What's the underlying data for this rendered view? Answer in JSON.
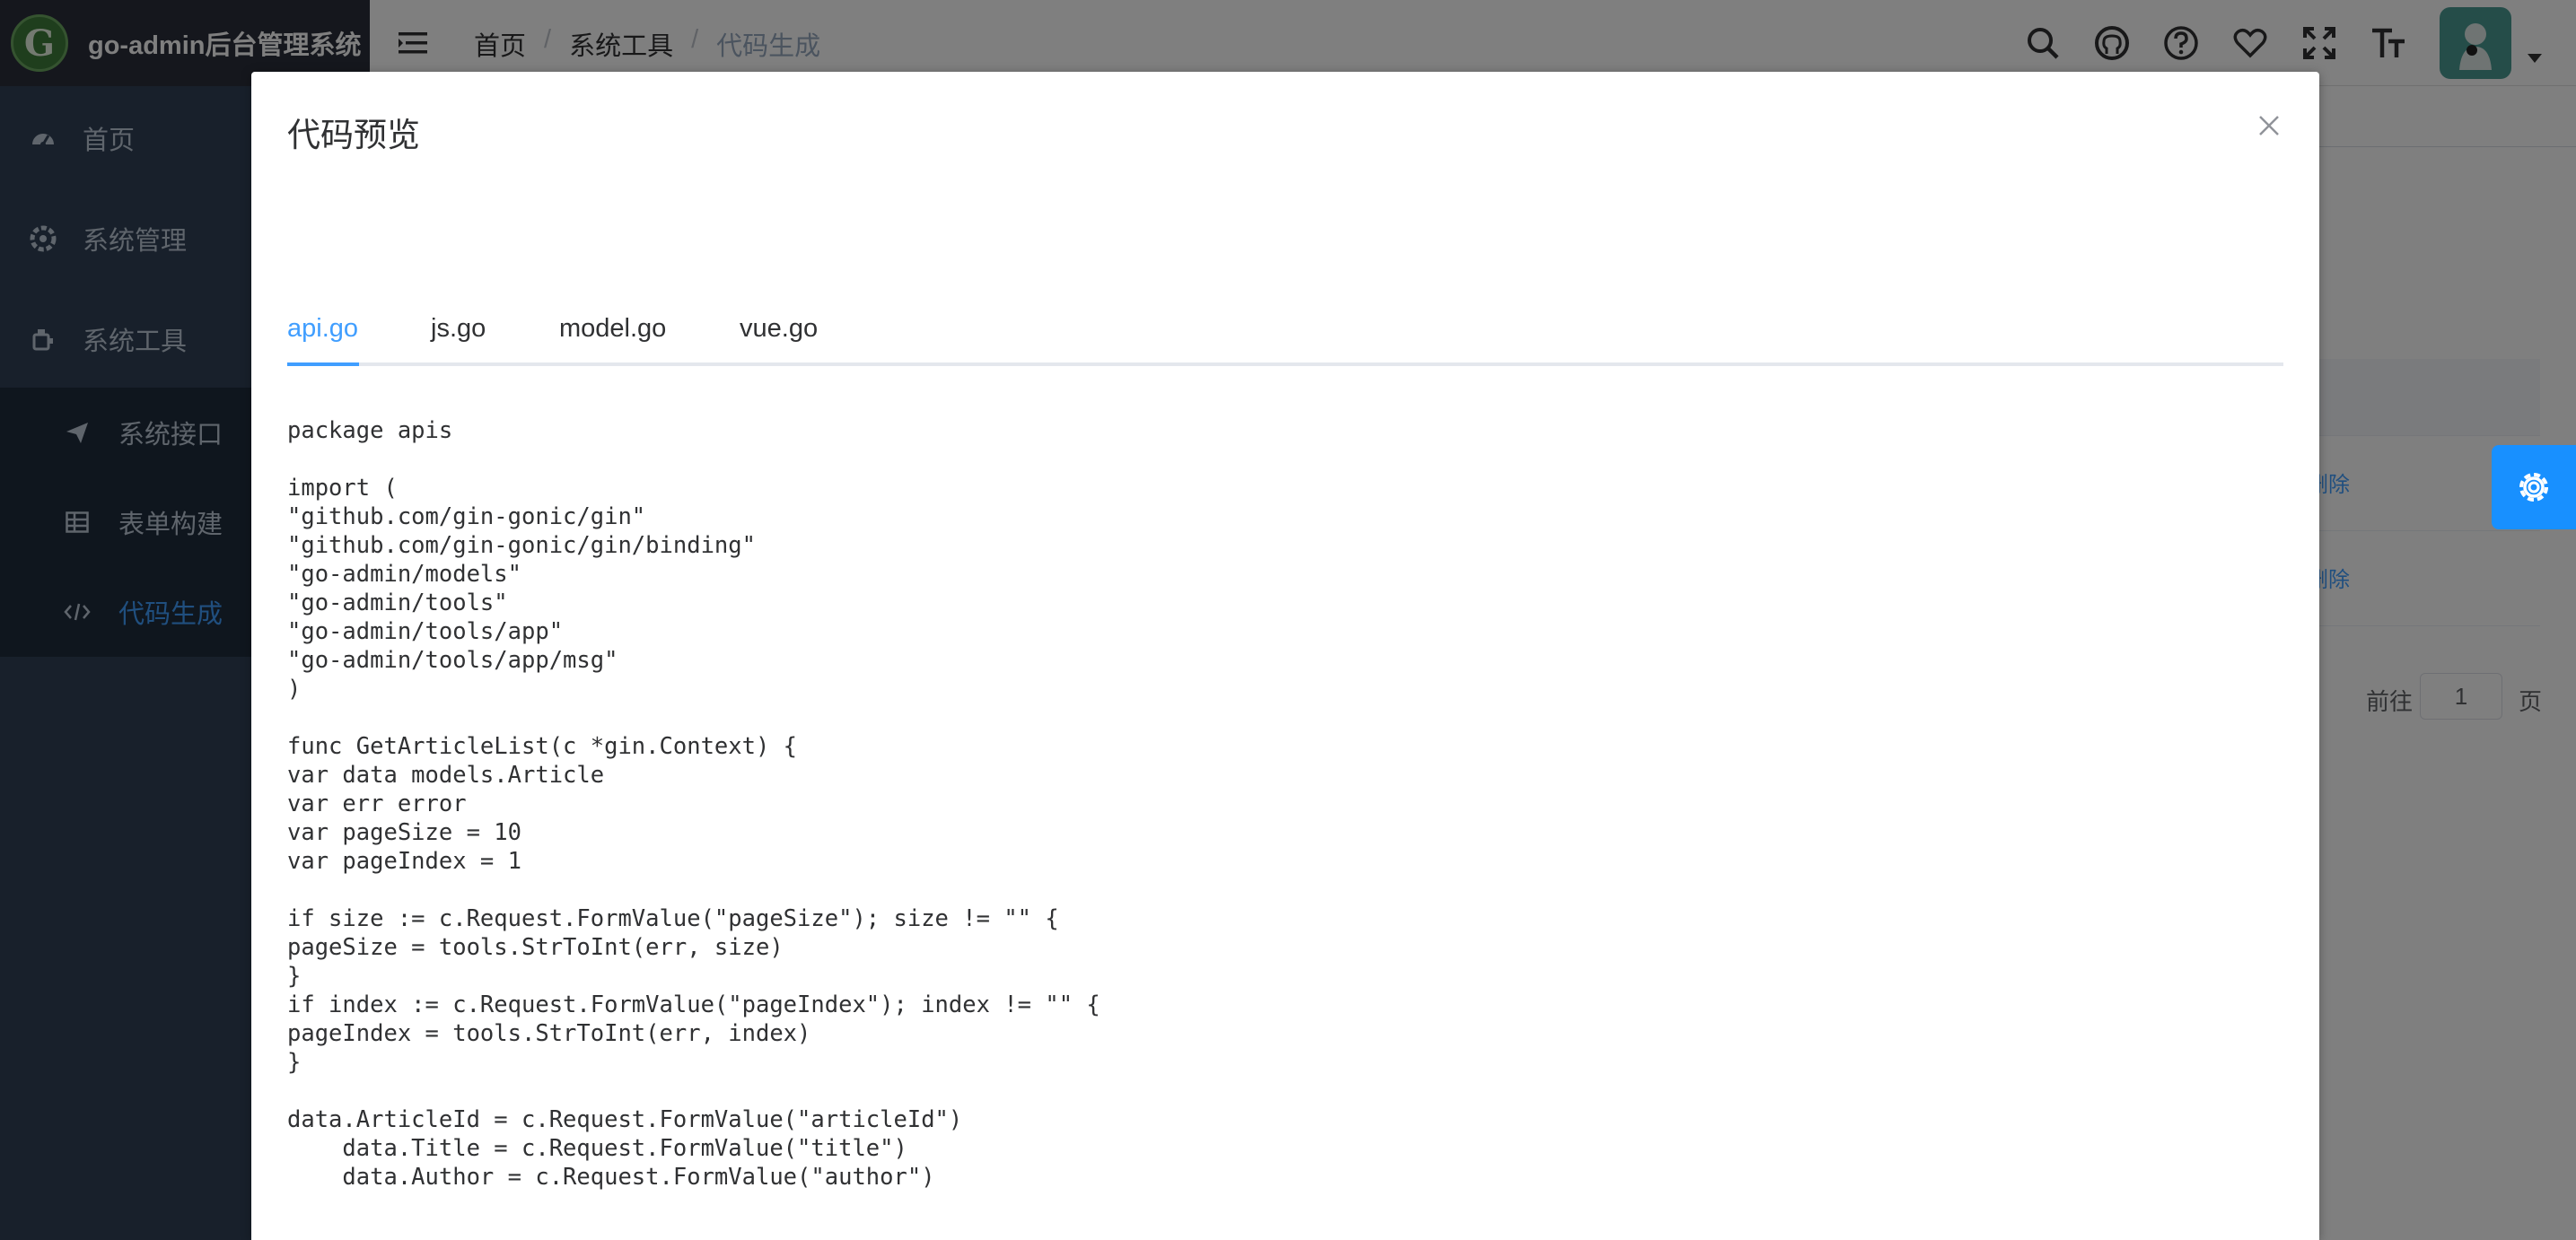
{
  "app": {
    "title": "go-admin后台管理系统",
    "logo_letter": "G"
  },
  "sidebar": {
    "items": [
      {
        "label": "首页",
        "icon": "dashboard-icon"
      },
      {
        "label": "系统管理",
        "icon": "settings-wheel-icon"
      },
      {
        "label": "系统工具",
        "icon": "tool-icon"
      }
    ],
    "subitems": [
      {
        "label": "系统接口",
        "icon": "send-icon"
      },
      {
        "label": "表单构建",
        "icon": "table-icon"
      },
      {
        "label": "代码生成",
        "icon": "code-icon"
      }
    ]
  },
  "header": {
    "breadcrumb": [
      "首页",
      "系统工具",
      "代码生成"
    ],
    "breadcrumb_sep": "/",
    "icons": [
      "search-icon",
      "github-icon",
      "help-icon",
      "heart-icon",
      "fullscreen-icon",
      "font-size-icon"
    ]
  },
  "background_page": {
    "row_action": "删除",
    "pager_goto": "前往",
    "pager_value": "1",
    "pager_page": "页"
  },
  "dialog": {
    "title": "代码预览",
    "tabs": [
      {
        "label": "api.go",
        "active": true
      },
      {
        "label": "js.go",
        "active": false
      },
      {
        "label": "model.go",
        "active": false
      },
      {
        "label": "vue.go",
        "active": false
      }
    ],
    "code": "package apis\n\nimport (\n\"github.com/gin-gonic/gin\"\n\"github.com/gin-gonic/gin/binding\"\n\"go-admin/models\"\n\"go-admin/tools\"\n\"go-admin/tools/app\"\n\"go-admin/tools/app/msg\"\n)\n\nfunc GetArticleList(c *gin.Context) {\nvar data models.Article\nvar err error\nvar pageSize = 10\nvar pageIndex = 1\n\nif size := c.Request.FormValue(\"pageSize\"); size != \"\" {\npageSize = tools.StrToInt(err, size)\n}\nif index := c.Request.FormValue(\"pageIndex\"); index != \"\" {\npageIndex = tools.StrToInt(err, index)\n}\n\ndata.ArticleId = c.Request.FormValue(\"articleId\")\n    data.Title = c.Request.FormValue(\"title\")\n    data.Author = c.Request.FormValue(\"author\")\n\n\ndata.DataScope = tools.GetUserIdStr(c)\nresult, count, err := data.GetPage(pageSize, pageIndex)"
  },
  "colors": {
    "primary": "#409eff",
    "sidebar_bg": "#304156",
    "submenu_bg": "#1f2d3d",
    "fab": "#1890ff"
  }
}
